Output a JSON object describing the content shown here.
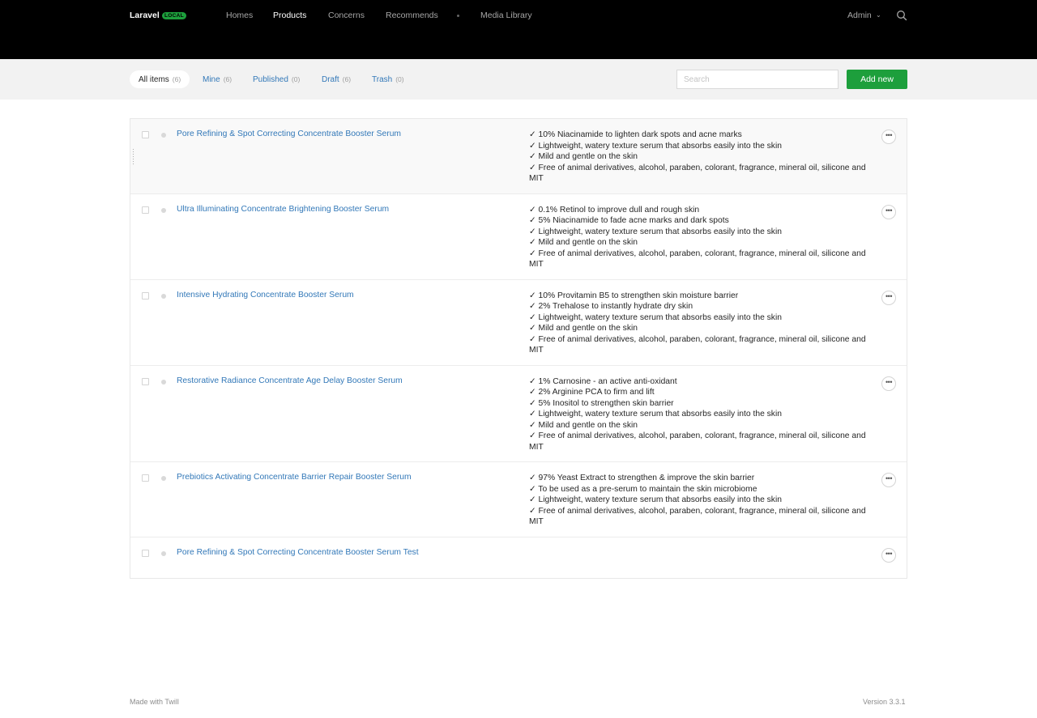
{
  "header": {
    "brand": "Laravel",
    "env_badge": "LOCAL",
    "nav": [
      "Homes",
      "Products",
      "Concerns",
      "Recommends",
      "Media Library"
    ],
    "active_nav": "Products",
    "user": "Admin",
    "icons": {
      "search": "search-icon",
      "user_menu": "chevron-down-icon"
    }
  },
  "filters": [
    {
      "label": "All items",
      "count": "(6)"
    },
    {
      "label": "Mine",
      "count": "(6)"
    },
    {
      "label": "Published",
      "count": "(0)"
    },
    {
      "label": "Draft",
      "count": "(6)"
    },
    {
      "label": "Trash",
      "count": "(0)"
    }
  ],
  "search": {
    "placeholder": "Search"
  },
  "add_button": "Add new",
  "rows": [
    {
      "title": "Pore Refining & Spot Correcting Concentrate Booster Serum",
      "lines": [
        "✓ 10% Niacinamide to lighten dark spots and acne marks",
        "✓ Lightweight, watery texture serum that absorbs easily into the skin",
        "✓ Mild and gentle on the skin",
        "✓ Free of animal derivatives, alcohol, paraben, colorant, fragrance, mineral oil, silicone and MIT"
      ]
    },
    {
      "title": "Ultra Illuminating Concentrate Brightening Booster Serum",
      "lines": [
        "✓ 0.1% Retinol to improve dull and rough skin",
        "✓ 5% Niacinamide to fade acne marks and dark spots",
        "✓ Lightweight, watery texture serum that absorbs easily into the skin",
        "✓ Mild and gentle on the skin",
        "✓ Free of animal derivatives, alcohol, paraben, colorant, fragrance, mineral oil, silicone and MIT"
      ]
    },
    {
      "title": "Intensive Hydrating Concentrate Booster Serum",
      "lines": [
        "✓ 10% Provitamin B5 to strengthen skin moisture barrier",
        "✓ 2% Trehalose to instantly hydrate dry skin",
        "✓ Lightweight, watery texture serum that absorbs easily into the skin",
        "✓ Mild and gentle on the skin",
        "✓ Free of animal derivatives, alcohol, paraben, colorant, fragrance, mineral oil, silicone and MIT"
      ]
    },
    {
      "title": "Restorative Radiance Concentrate Age Delay Booster Serum",
      "lines": [
        "✓ 1% Carnosine - an active anti-oxidant",
        "✓ 2% Arginine PCA to firm and lift",
        "✓ 5% Inositol to strengthen skin barrier",
        "✓ Lightweight, watery texture serum that absorbs easily into the skin",
        "✓ Mild and gentle on the skin",
        "✓ Free of animal derivatives, alcohol, paraben, colorant, fragrance, mineral oil, silicone and MIT"
      ]
    },
    {
      "title": "Prebiotics Activating Concentrate Barrier Repair Booster Serum",
      "lines": [
        "✓ 97% Yeast Extract to strengthen & improve the skin barrier",
        "✓ To be used as a pre-serum to maintain the skin microbiome",
        "✓ Lightweight, watery texture serum that absorbs easily into the skin",
        "✓ Free of animal derivatives, alcohol, paraben, colorant, fragrance, mineral oil, silicone and MIT"
      ]
    },
    {
      "title": "Pore Refining & Spot Correcting Concentrate Booster Serum Test",
      "lines": []
    }
  ],
  "row_actions_icon": "more-horizontal-icon",
  "footer": {
    "left": "Made with Twill",
    "right": "Version 3.3.1"
  },
  "colors": {
    "accent": "#1d9f3c",
    "link": "#3278b8",
    "header_bg": "#000000"
  }
}
